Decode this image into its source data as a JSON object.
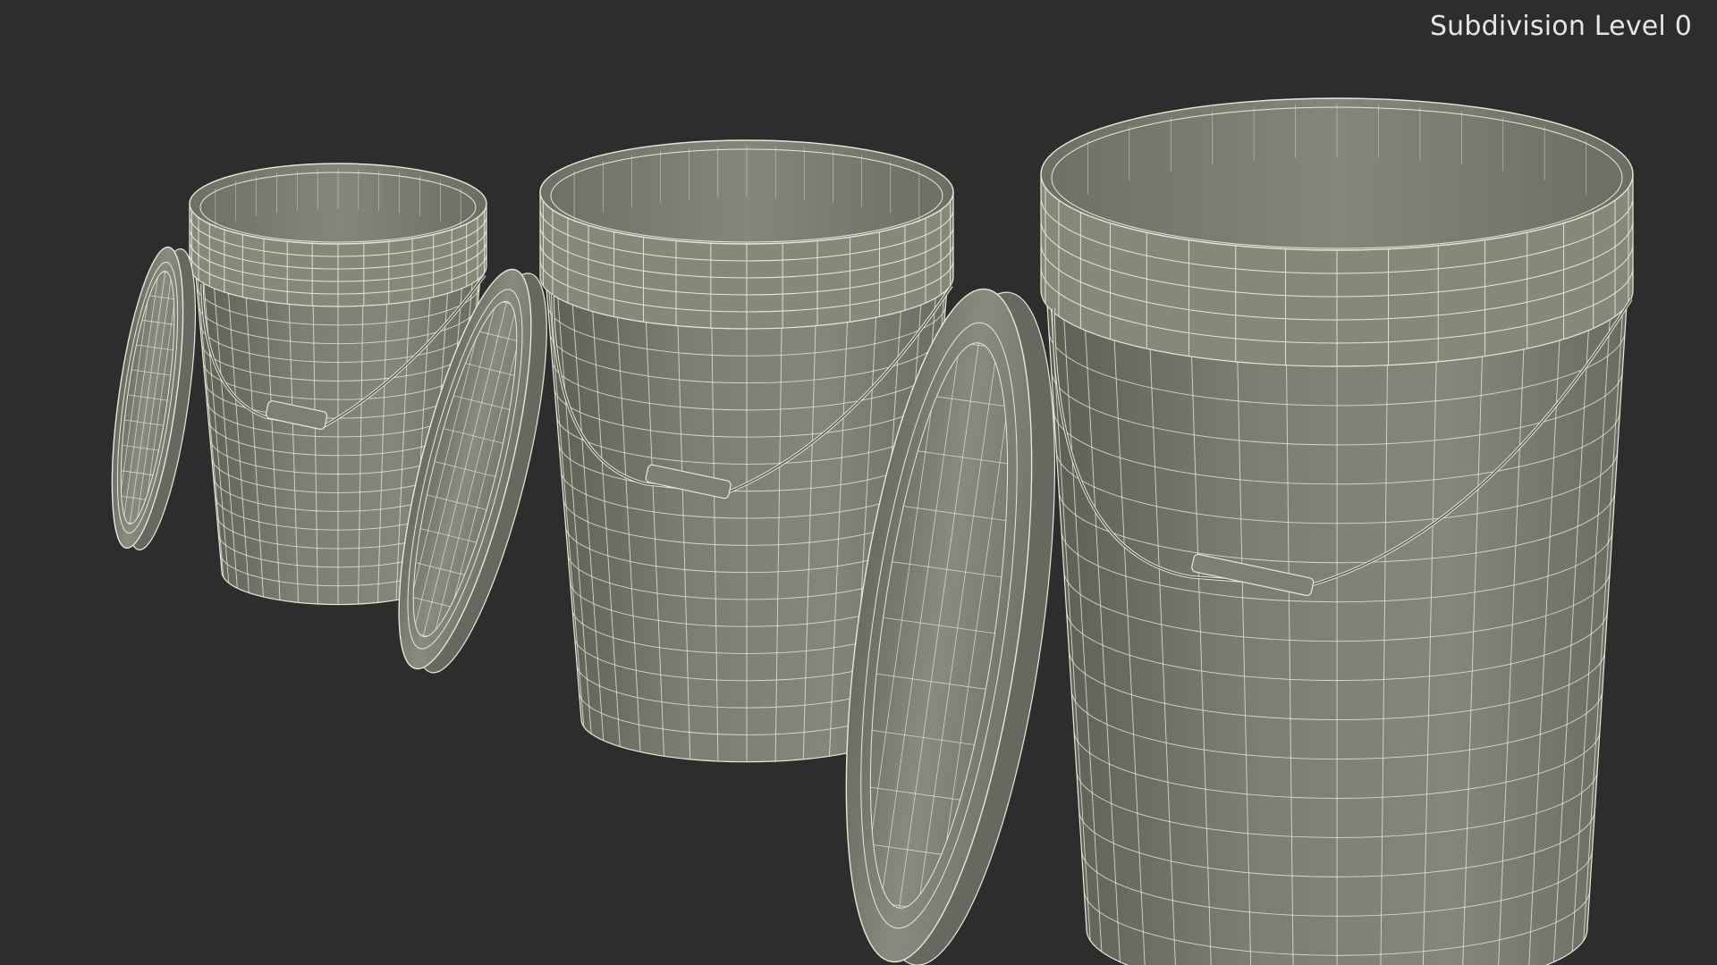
{
  "viewport": {
    "overlay_label": "Subdivision Level 0",
    "background_color": "#2d2d2d",
    "mesh_fill_color": "#7a7b70",
    "wire_color": "#e9e8d8"
  },
  "scene": {
    "objects": [
      {
        "name": "small-bucket"
      },
      {
        "name": "small-bucket-lid"
      },
      {
        "name": "medium-bucket"
      },
      {
        "name": "medium-bucket-lid"
      },
      {
        "name": "large-bucket"
      },
      {
        "name": "large-bucket-lid"
      }
    ]
  }
}
